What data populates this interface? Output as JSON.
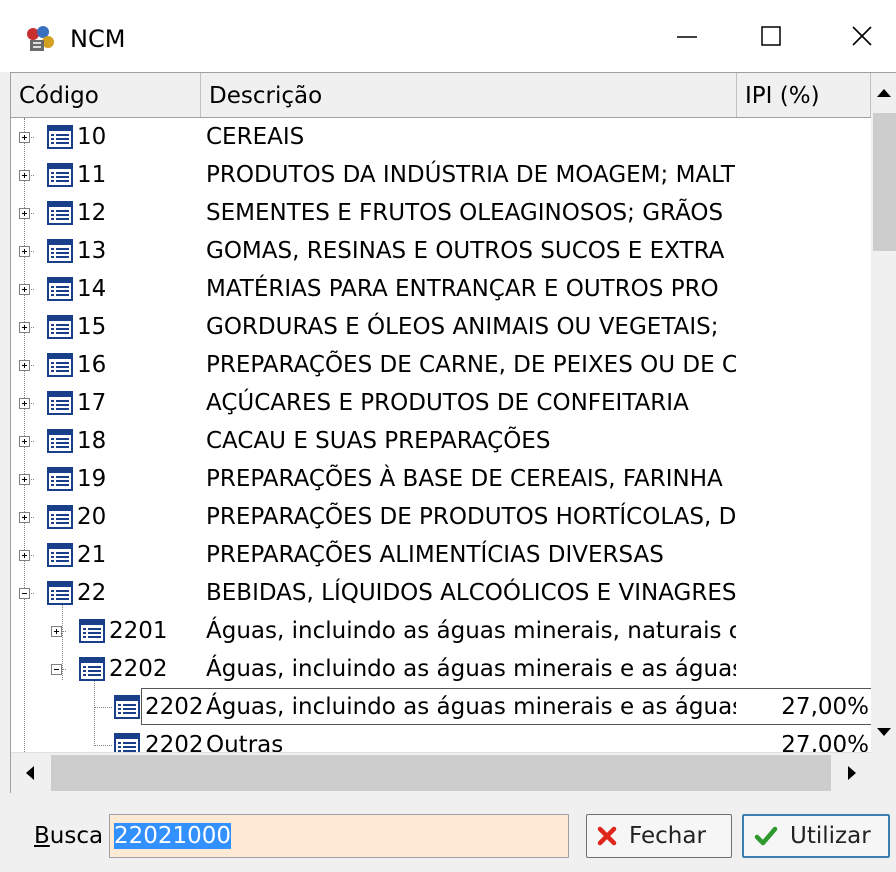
{
  "window": {
    "title": "NCM"
  },
  "grid": {
    "columns": [
      "Código",
      "Descrição",
      "IPI (%)"
    ],
    "rows": [
      {
        "code": "10",
        "desc": "CEREAIS",
        "ipi": "",
        "level": 0,
        "exp": "plus"
      },
      {
        "code": "11",
        "desc": "PRODUTOS DA INDÚSTRIA DE MOAGEM; MALT",
        "ipi": "",
        "level": 0,
        "exp": "plus"
      },
      {
        "code": "12",
        "desc": "SEMENTES E FRUTOS OLEAGINOSOS; GRÃOS",
        "ipi": "",
        "level": 0,
        "exp": "plus"
      },
      {
        "code": "13",
        "desc": "GOMAS, RESINAS E OUTROS SUCOS E EXTRA",
        "ipi": "",
        "level": 0,
        "exp": "plus"
      },
      {
        "code": "14",
        "desc": "MATÉRIAS PARA ENTRANÇAR E OUTROS PRO",
        "ipi": "",
        "level": 0,
        "exp": "plus"
      },
      {
        "code": "15",
        "desc": "GORDURAS E ÓLEOS ANIMAIS OU VEGETAIS;",
        "ipi": "",
        "level": 0,
        "exp": "plus"
      },
      {
        "code": "16",
        "desc": "PREPARAÇÕES DE CARNE, DE PEIXES OU DE C",
        "ipi": "",
        "level": 0,
        "exp": "plus"
      },
      {
        "code": "17",
        "desc": "AÇÚCARES E PRODUTOS DE CONFEITARIA",
        "ipi": "",
        "level": 0,
        "exp": "plus"
      },
      {
        "code": "18",
        "desc": "CACAU E SUAS PREPARAÇÕES",
        "ipi": "",
        "level": 0,
        "exp": "plus"
      },
      {
        "code": "19",
        "desc": "PREPARAÇÕES À BASE DE CEREAIS, FARINHA",
        "ipi": "",
        "level": 0,
        "exp": "plus"
      },
      {
        "code": "20",
        "desc": "PREPARAÇÕES DE PRODUTOS HORTÍCOLAS, D",
        "ipi": "",
        "level": 0,
        "exp": "plus"
      },
      {
        "code": "21",
        "desc": "PREPARAÇÕES ALIMENTÍCIAS DIVERSAS",
        "ipi": "",
        "level": 0,
        "exp": "plus"
      },
      {
        "code": "22",
        "desc": "BEBIDAS, LÍQUIDOS ALCOÓLICOS E VINAGRES",
        "ipi": "",
        "level": 0,
        "exp": "minus"
      },
      {
        "code": "2201",
        "desc": "Águas, incluindo as águas minerais, naturais o",
        "ipi": "",
        "level": 1,
        "exp": "plus"
      },
      {
        "code": "2202",
        "desc": "Águas, incluindo as águas minerais e as águas",
        "ipi": "",
        "level": 1,
        "exp": "minus"
      },
      {
        "code": "2202",
        "desc": "Águas, incluindo as águas minerais e as águas",
        "ipi": "27,00%",
        "level": 2,
        "exp": "none",
        "selected": true
      },
      {
        "code": "2202",
        "desc": "Outras",
        "ipi": "27,00%",
        "level": 2,
        "exp": "none"
      }
    ]
  },
  "footer": {
    "search_label_underlined": "B",
    "search_label_rest": "usca",
    "search_value": "22021000",
    "close_label": "Fechar",
    "use_label": "Utilizar"
  },
  "icons": {
    "app": "ncm-app-icon",
    "minimize": "minimize-icon",
    "maximize": "maximize-icon",
    "close": "close-icon",
    "node": "list-node-icon",
    "fechar": "x-red-icon",
    "utilizar": "check-green-icon"
  },
  "colors": {
    "input_bg": "#fde9d4",
    "selection": "#3390ff",
    "close_x": "#e0261b",
    "check": "#2e9a2e"
  }
}
